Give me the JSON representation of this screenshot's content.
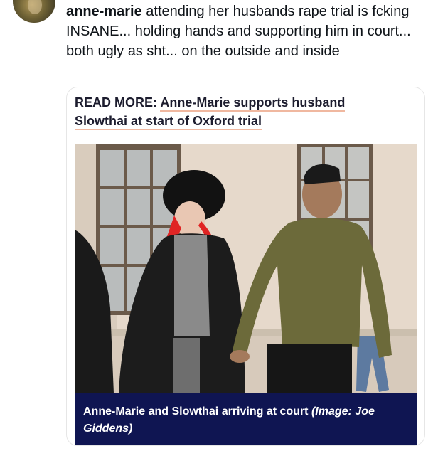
{
  "tweet": {
    "username": "anne-marie",
    "text": "attending her husbands rape trial is fcking INSANE... holding hands and supporting him in court... both ugly as sht... on the outside and inside"
  },
  "article_card": {
    "read_more_prefix": "READ MORE:",
    "headline": "Anne-Marie supports husband Slowthai at start of Oxford trial",
    "caption_text": "Anne-Marie and Slowthai arriving at court",
    "caption_credit": "(Image: Joe Giddens)"
  },
  "colors": {
    "caption_bg": "#0f1552",
    "headline_underline": "#f0b8a0",
    "text": "#0f1419"
  }
}
